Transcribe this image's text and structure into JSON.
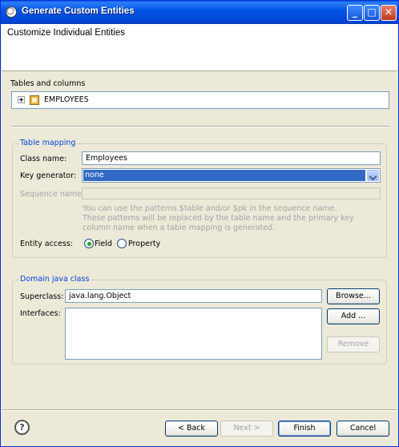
{
  "window": {
    "title": "Generate Custom Entities",
    "icon": "eclipse-gear-icon"
  },
  "header": {
    "title": "Customize Individual Entities"
  },
  "tables": {
    "label": "Tables and columns",
    "items": [
      {
        "label": "EMPLOYEES",
        "icon": "table-icon",
        "expanded": false
      }
    ]
  },
  "table_mapping": {
    "group_title": "Table mapping",
    "class_name_label": "Class name:",
    "class_name_value": "Employees",
    "key_generator_label": "Key generator:",
    "key_generator_value": "none",
    "sequence_name_label": "Sequence name:",
    "sequence_name_value": "",
    "hint_line1": "You can use the patterns $table and/or $pk in the sequence name.",
    "hint_line2": "These patterns will be replaced by the table name and the primary key",
    "hint_line3": "column name when a table mapping is generated.",
    "entity_access_label": "Entity access:",
    "access_options": [
      "Field",
      "Property"
    ],
    "access_selected": "Field"
  },
  "domain_class": {
    "group_title": "Domain java class",
    "superclass_label": "Superclass:",
    "superclass_value": "java.lang.Object",
    "browse_label": "Browse...",
    "interfaces_label": "Interfaces:",
    "add_label": "Add ...",
    "remove_label": "Remove"
  },
  "footer": {
    "help_icon": "help-icon",
    "back_label": "< Back",
    "next_label": "Next >",
    "finish_label": "Finish",
    "cancel_label": "Cancel"
  }
}
